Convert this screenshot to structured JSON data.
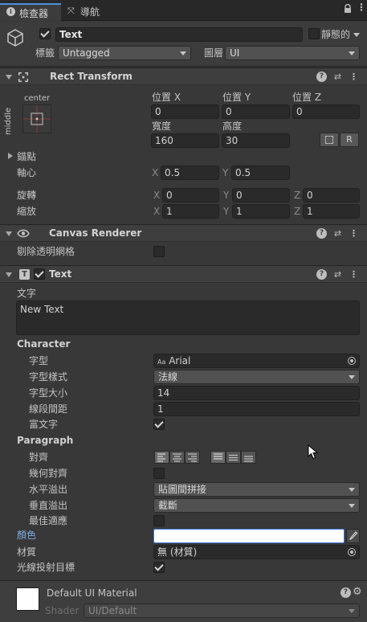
{
  "tabs": {
    "inspector": "檢查器",
    "navigation": "導航"
  },
  "gameobject": {
    "name": "Text",
    "active": true,
    "static_label": "靜態的",
    "tag_label": "標籤",
    "tag_value": "Untagged",
    "layer_label": "圖層",
    "layer_value": "UI"
  },
  "rect_transform": {
    "title": "Rect Transform",
    "anchor_preset_h": "center",
    "anchor_preset_v": "middle",
    "pos_x_label": "位置 X",
    "pos_y_label": "位置 Y",
    "pos_z_label": "位置 Z",
    "pos_x": "0",
    "pos_y": "0",
    "pos_z": "0",
    "width_label": "寬度",
    "height_label": "高度",
    "width": "160",
    "height": "30",
    "r_button": "R",
    "anchors_label": "錨點",
    "pivot_label": "軸心",
    "pivot_x": "0.5",
    "pivot_y": "0.5",
    "rotation_label": "旋轉",
    "rot_x": "0",
    "rot_y": "0",
    "rot_z": "0",
    "scale_label": "縮放",
    "scale_x": "1",
    "scale_y": "1",
    "scale_z": "1",
    "x": "X",
    "y": "Y",
    "z": "Z"
  },
  "canvas_renderer": {
    "title": "Canvas Renderer",
    "cull_label": "剔除透明網格",
    "cull": false
  },
  "text_component": {
    "title": "Text",
    "enabled": true,
    "text_label": "文字",
    "text_value": "New Text",
    "character_header": "Character",
    "font_label": "字型",
    "font_value": "Arial",
    "font_prefix": "Aa",
    "font_style_label": "字型樣式",
    "font_style_value": "法線",
    "font_size_label": "字型大小",
    "font_size_value": "14",
    "line_spacing_label": "線段間距",
    "line_spacing_value": "1",
    "rich_text_label": "富文字",
    "rich_text": true,
    "paragraph_header": "Paragraph",
    "alignment_label": "對齊",
    "align_by_geometry_label": "幾何對齊",
    "align_by_geometry": false,
    "h_overflow_label": "水平溢出",
    "h_overflow_value": "貼圖間拼接",
    "v_overflow_label": "垂直溢出",
    "v_overflow_value": "截斷",
    "best_fit_label": "最佳適應",
    "best_fit": false,
    "color_label": "顏色",
    "color_value": "#FFFFFF",
    "material_label": "材質",
    "material_value": "無 (材質)",
    "raycast_label": "光線投射目標",
    "raycast": true
  },
  "material_footer": {
    "name": "Default UI Material",
    "shader_label": "Shader",
    "shader_value": "UI/Default"
  },
  "colors": {
    "bg": "#383838",
    "header": "#3e3e3e",
    "field": "#2a2a2a",
    "accent": "#4d90d8"
  }
}
